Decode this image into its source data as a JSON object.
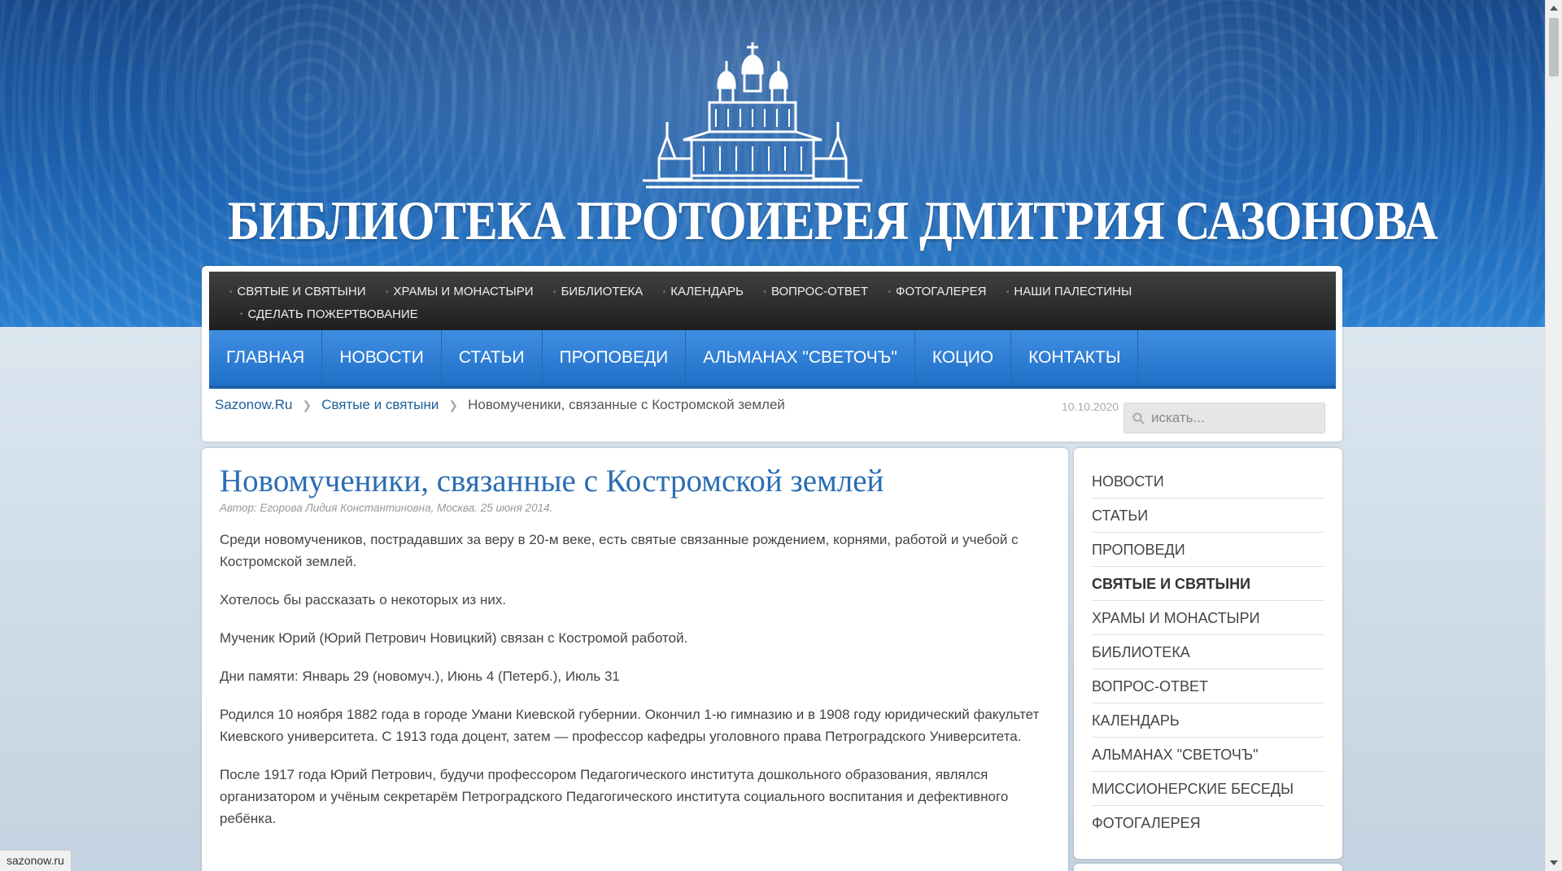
{
  "header": {
    "site_title": "БИБЛИОТЕКА ПРОТОИЕРЕЯ ДМИТРИЯ САЗОНОВА"
  },
  "top_menu": [
    "СВЯТЫЕ И СВЯТЫНИ",
    "ХРАМЫ И МОНАСТЫРИ",
    "БИБЛИОТЕКА",
    "КАЛЕНДАРЬ",
    "ВОПРОС-ОТВЕТ",
    "ФОТОГАЛЕРЕЯ",
    "НАШИ ПАЛЕСТИНЫ",
    "СДЕЛАТЬ ПОЖЕРТВОВАНИЕ"
  ],
  "main_nav": [
    "ГЛАВНАЯ",
    "НОВОСТИ",
    "СТАТЬИ",
    "ПРОПОВЕДИ",
    "АЛЬМАНАХ \"СВЕТОЧЪ\"",
    "КОЦИО",
    "КОНТАКТЫ"
  ],
  "breadcrumb": {
    "home": "Sazonow.Ru",
    "section": "Святые и святыни",
    "current": "Новомученики, связанные с Костромской землей"
  },
  "date": "10.10.2020",
  "search": {
    "placeholder": "искать..."
  },
  "article": {
    "title": "Новомученики, связанные с Костромской землей",
    "meta": "Автор: Егорова Лидия Константиновна, Москва. 25 июня 2014.",
    "paragraphs": [
      "Среди новомучеников, пострадавших за веру в 20-м веке, есть святые связанные рождением, корнями, работой и учебой с Костромской землей.",
      "Хотелось бы рассказать о некоторых из них.",
      "Мученик Юрий (Юрий Петрович Новицкий) связан с Костромой работой.",
      "Дни памяти: Январь 29 (новомуч.), Июнь 4 (Петерб.), Июль 31",
      "Родился 10 ноября 1882 года в городе Умани Киевской губернии. Окончил 1-ю гимназию и в 1908 году юридический факультет Киевского университета. С 1913 года доцент, затем — профессор кафедры уголовного права Петроградского Университета.",
      "После 1917 года Юрий Петрович, будучи профессором Педагогического института дошкольного образования, являлся организатором и учёным секретарём Петроградского Педагогического института социального воспитания и дефективного ребёнка."
    ]
  },
  "sidebar": {
    "items": [
      "НОВОСТИ",
      "СТАТЬИ",
      "ПРОПОВЕДИ",
      "СВЯТЫЕ И СВЯТЫНИ",
      "ХРАМЫ И МОНАСТЫРИ",
      "БИБЛИОТЕКА",
      "ВОПРОС-ОТВЕТ",
      "КАЛЕНДАРЬ",
      "АЛЬМАНАХ \"СВЕТОЧЪ\"",
      "МИССИОНЕРСКИЕ БЕСЕДЫ",
      "ФОТОГАЛЕРЕЯ"
    ],
    "active_item": "СВЯТЫЕ И СВЯТЫНИ"
  },
  "status_bar": {
    "url": "sazonow.ru"
  },
  "colors": {
    "header_blue": "#1e63b1",
    "nav_blue": "#2f7fd6",
    "title_blue": "#2a6db3",
    "link_blue": "#1d5f9a",
    "topbar_dark": "#2b2b2b"
  },
  "icons": [
    "church-logo",
    "search-icon",
    "chevron-right-icon",
    "arrow-up-icon",
    "arrow-down-icon"
  ]
}
